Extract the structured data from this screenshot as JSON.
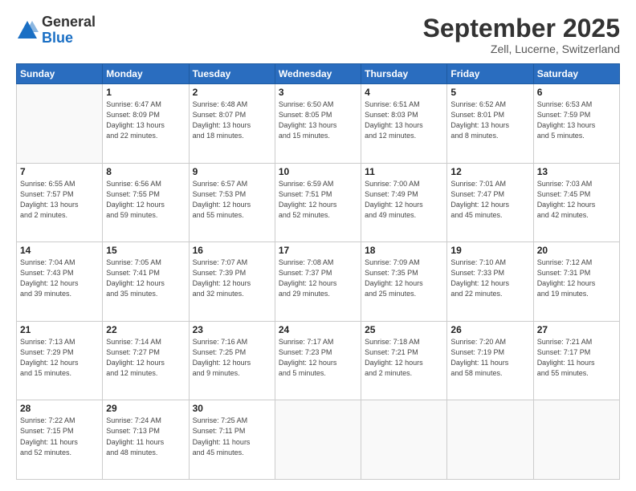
{
  "logo": {
    "general": "General",
    "blue": "Blue"
  },
  "title": "September 2025",
  "subtitle": "Zell, Lucerne, Switzerland",
  "headers": [
    "Sunday",
    "Monday",
    "Tuesday",
    "Wednesday",
    "Thursday",
    "Friday",
    "Saturday"
  ],
  "weeks": [
    [
      {
        "num": "",
        "info": ""
      },
      {
        "num": "1",
        "info": "Sunrise: 6:47 AM\nSunset: 8:09 PM\nDaylight: 13 hours\nand 22 minutes."
      },
      {
        "num": "2",
        "info": "Sunrise: 6:48 AM\nSunset: 8:07 PM\nDaylight: 13 hours\nand 18 minutes."
      },
      {
        "num": "3",
        "info": "Sunrise: 6:50 AM\nSunset: 8:05 PM\nDaylight: 13 hours\nand 15 minutes."
      },
      {
        "num": "4",
        "info": "Sunrise: 6:51 AM\nSunset: 8:03 PM\nDaylight: 13 hours\nand 12 minutes."
      },
      {
        "num": "5",
        "info": "Sunrise: 6:52 AM\nSunset: 8:01 PM\nDaylight: 13 hours\nand 8 minutes."
      },
      {
        "num": "6",
        "info": "Sunrise: 6:53 AM\nSunset: 7:59 PM\nDaylight: 13 hours\nand 5 minutes."
      }
    ],
    [
      {
        "num": "7",
        "info": "Sunrise: 6:55 AM\nSunset: 7:57 PM\nDaylight: 13 hours\nand 2 minutes."
      },
      {
        "num": "8",
        "info": "Sunrise: 6:56 AM\nSunset: 7:55 PM\nDaylight: 12 hours\nand 59 minutes."
      },
      {
        "num": "9",
        "info": "Sunrise: 6:57 AM\nSunset: 7:53 PM\nDaylight: 12 hours\nand 55 minutes."
      },
      {
        "num": "10",
        "info": "Sunrise: 6:59 AM\nSunset: 7:51 PM\nDaylight: 12 hours\nand 52 minutes."
      },
      {
        "num": "11",
        "info": "Sunrise: 7:00 AM\nSunset: 7:49 PM\nDaylight: 12 hours\nand 49 minutes."
      },
      {
        "num": "12",
        "info": "Sunrise: 7:01 AM\nSunset: 7:47 PM\nDaylight: 12 hours\nand 45 minutes."
      },
      {
        "num": "13",
        "info": "Sunrise: 7:03 AM\nSunset: 7:45 PM\nDaylight: 12 hours\nand 42 minutes."
      }
    ],
    [
      {
        "num": "14",
        "info": "Sunrise: 7:04 AM\nSunset: 7:43 PM\nDaylight: 12 hours\nand 39 minutes."
      },
      {
        "num": "15",
        "info": "Sunrise: 7:05 AM\nSunset: 7:41 PM\nDaylight: 12 hours\nand 35 minutes."
      },
      {
        "num": "16",
        "info": "Sunrise: 7:07 AM\nSunset: 7:39 PM\nDaylight: 12 hours\nand 32 minutes."
      },
      {
        "num": "17",
        "info": "Sunrise: 7:08 AM\nSunset: 7:37 PM\nDaylight: 12 hours\nand 29 minutes."
      },
      {
        "num": "18",
        "info": "Sunrise: 7:09 AM\nSunset: 7:35 PM\nDaylight: 12 hours\nand 25 minutes."
      },
      {
        "num": "19",
        "info": "Sunrise: 7:10 AM\nSunset: 7:33 PM\nDaylight: 12 hours\nand 22 minutes."
      },
      {
        "num": "20",
        "info": "Sunrise: 7:12 AM\nSunset: 7:31 PM\nDaylight: 12 hours\nand 19 minutes."
      }
    ],
    [
      {
        "num": "21",
        "info": "Sunrise: 7:13 AM\nSunset: 7:29 PM\nDaylight: 12 hours\nand 15 minutes."
      },
      {
        "num": "22",
        "info": "Sunrise: 7:14 AM\nSunset: 7:27 PM\nDaylight: 12 hours\nand 12 minutes."
      },
      {
        "num": "23",
        "info": "Sunrise: 7:16 AM\nSunset: 7:25 PM\nDaylight: 12 hours\nand 9 minutes."
      },
      {
        "num": "24",
        "info": "Sunrise: 7:17 AM\nSunset: 7:23 PM\nDaylight: 12 hours\nand 5 minutes."
      },
      {
        "num": "25",
        "info": "Sunrise: 7:18 AM\nSunset: 7:21 PM\nDaylight: 12 hours\nand 2 minutes."
      },
      {
        "num": "26",
        "info": "Sunrise: 7:20 AM\nSunset: 7:19 PM\nDaylight: 11 hours\nand 58 minutes."
      },
      {
        "num": "27",
        "info": "Sunrise: 7:21 AM\nSunset: 7:17 PM\nDaylight: 11 hours\nand 55 minutes."
      }
    ],
    [
      {
        "num": "28",
        "info": "Sunrise: 7:22 AM\nSunset: 7:15 PM\nDaylight: 11 hours\nand 52 minutes."
      },
      {
        "num": "29",
        "info": "Sunrise: 7:24 AM\nSunset: 7:13 PM\nDaylight: 11 hours\nand 48 minutes."
      },
      {
        "num": "30",
        "info": "Sunrise: 7:25 AM\nSunset: 7:11 PM\nDaylight: 11 hours\nand 45 minutes."
      },
      {
        "num": "",
        "info": ""
      },
      {
        "num": "",
        "info": ""
      },
      {
        "num": "",
        "info": ""
      },
      {
        "num": "",
        "info": ""
      }
    ]
  ]
}
